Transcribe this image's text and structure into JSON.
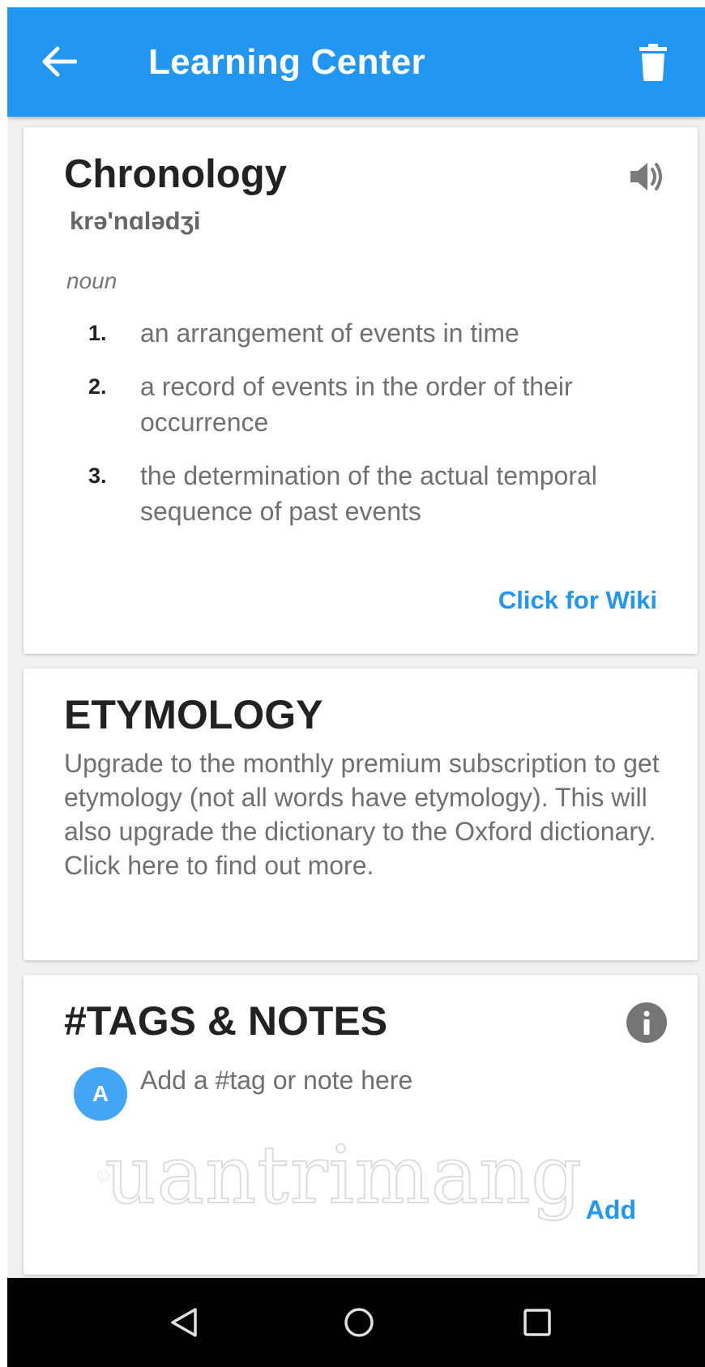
{
  "appbar": {
    "title": "Learning Center",
    "back_icon": "arrow-left-icon",
    "delete_icon": "trash-icon",
    "color": "#2196f3"
  },
  "definition": {
    "word": "Chronology",
    "phonetic": "krə'nɑlədʒi",
    "part_of_speech": "noun",
    "speaker_icon": "speaker-icon",
    "definitions": [
      {
        "number": "1.",
        "text": "an arrangement of events in time"
      },
      {
        "number": "2.",
        "text": "a record of events in the order of their occurrence"
      },
      {
        "number": "3.",
        "text": "the determination of the actual temporal sequence of past events"
      }
    ],
    "wiki_link": "Click for Wiki"
  },
  "etymology": {
    "title": "ETYMOLOGY",
    "text": "Upgrade to the monthly premium subscription to get etymology (not all words have etymology). This will also upgrade the dictionary to the Oxford dictionary. Click here to find out more."
  },
  "tags": {
    "title": "#TAGS & NOTES",
    "info_icon": "info-icon",
    "avatar_letter": "A",
    "placeholder": "Add a #tag or note here",
    "add_label": "Add",
    "watermark": "uantrimang"
  },
  "navbar": {
    "back_icon": "triangle-back-icon",
    "home_icon": "circle-home-icon",
    "recent_icon": "square-recents-icon"
  }
}
